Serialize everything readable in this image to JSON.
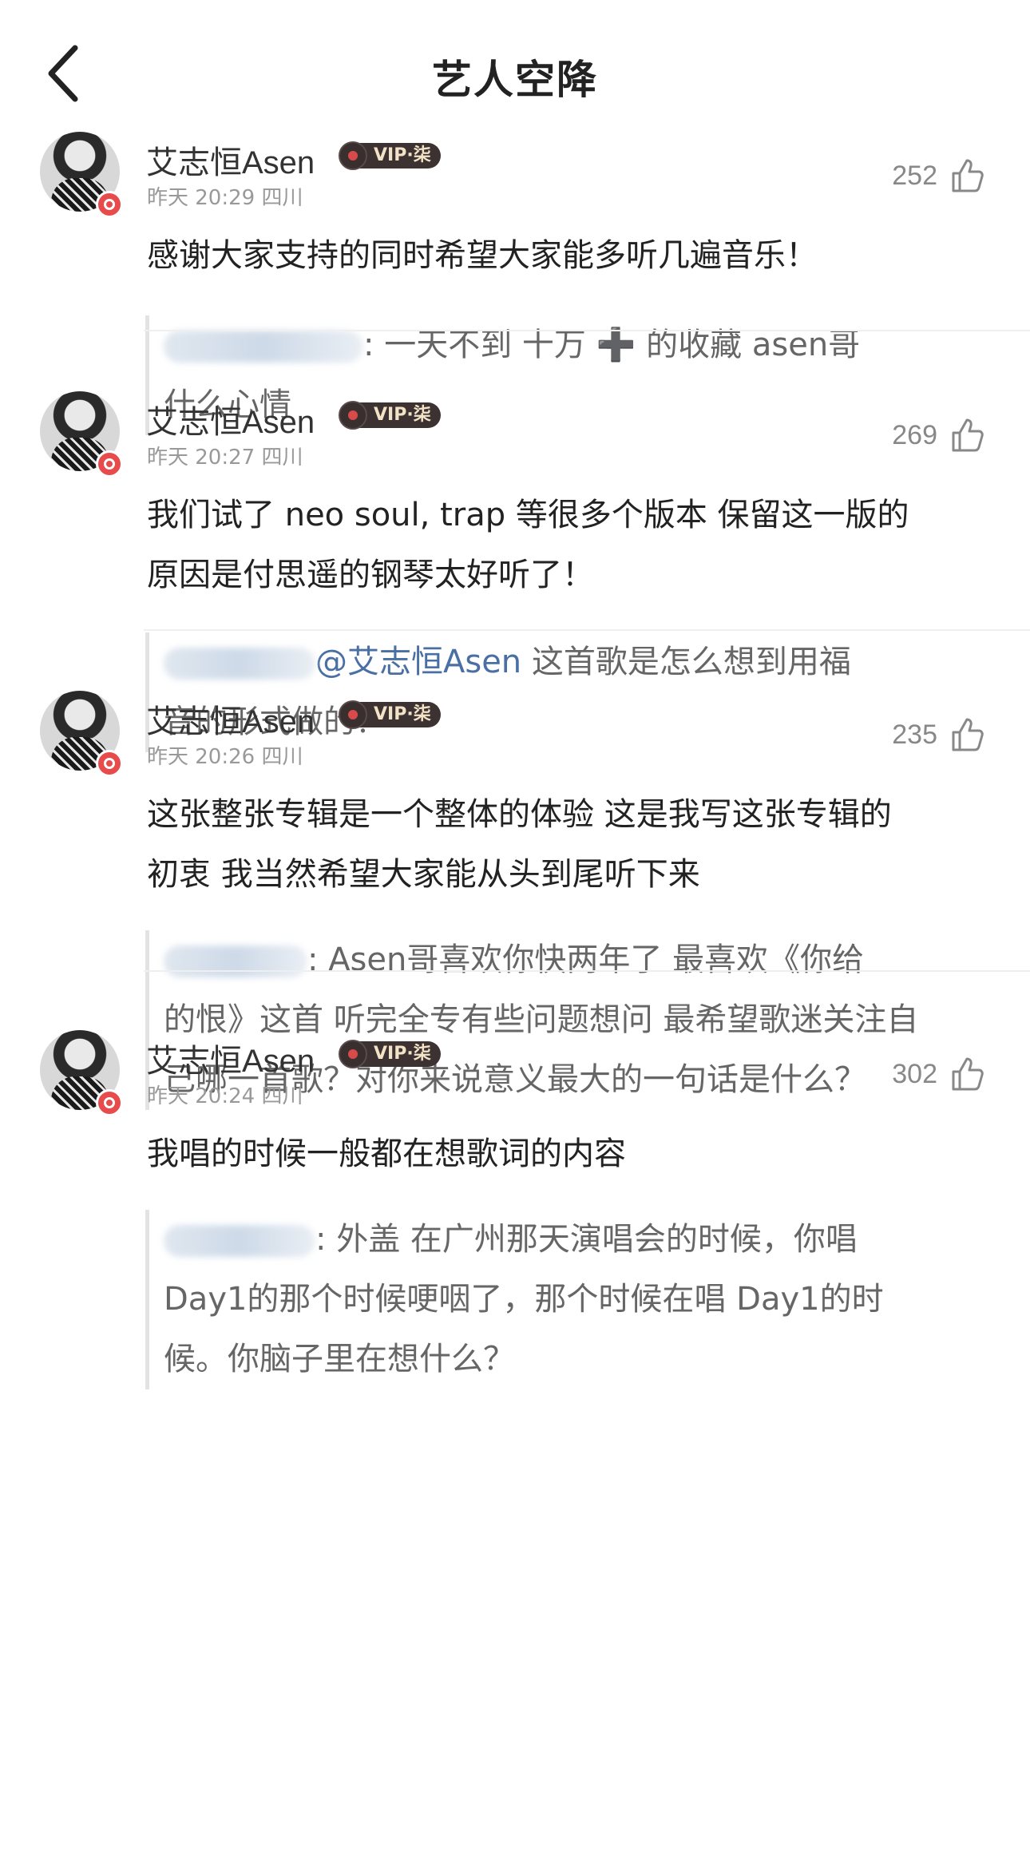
{
  "header": {
    "title": "艺人空降"
  },
  "comments": [
    {
      "username": "艾志恒Asen",
      "vip": "VIP·柒",
      "time": "昨天 20:29",
      "location": "四川",
      "likes": "252",
      "text_lines": [
        "感谢大家支持的同时希望大家能多听几遍音乐！"
      ],
      "reply_lines": [
        ": 一天不到 十万 ➕ 的收藏 asen哥",
        "什么心情"
      ]
    },
    {
      "username": "艾志恒Asen",
      "vip": "VIP·柒",
      "time": "昨天 20:27",
      "location": "四川",
      "likes": "269",
      "text_lines": [
        "我们试了 neo soul, trap 等很多个版本 保留这一版的",
        "原因是付思遥的钢琴太好听了！"
      ],
      "reply_mention": "@艾志恒Asen",
      "reply_lines": [
        " 这首歌是怎么想到用福",
        "音的形式做的？"
      ]
    },
    {
      "username": "艾志恒Asen",
      "vip": "VIP·柒",
      "time": "昨天 20:26",
      "location": "四川",
      "likes": "235",
      "text_lines": [
        "这张整张专辑是一个整体的体验 这是我写这张专辑的",
        "初衷 我当然希望大家能从头到尾听下来"
      ],
      "reply_lines": [
        ": Asen哥喜欢你快两年了 最喜欢《你给",
        "的恨》这首 听完全专有些问题想问 最希望歌迷关注自",
        "己哪一首歌？对你来说意义最大的一句话是什么？"
      ]
    },
    {
      "username": "艾志恒Asen",
      "vip": "VIP·柒",
      "time": "昨天 20:24",
      "location": "四川",
      "likes": "302",
      "text_lines": [
        "我唱的时候一般都在想歌词的内容"
      ],
      "reply_lines": [
        ": 外盖 在广州那天演唱会的时候，你唱",
        "Day1的那个时候哽咽了，那个时候在唱 Day1的时",
        "候。你脑子里在想什么？"
      ]
    }
  ]
}
